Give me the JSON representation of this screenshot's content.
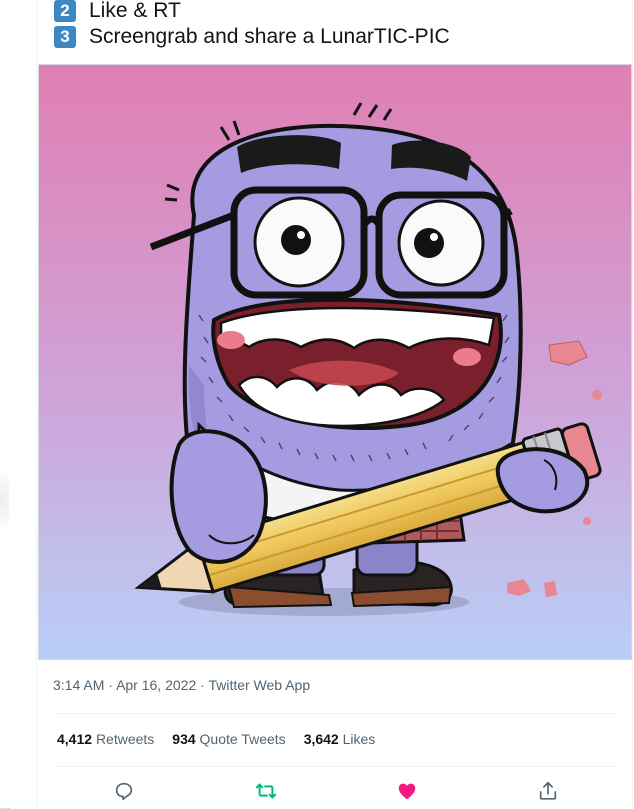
{
  "tweet": {
    "steps": [
      {
        "number": "2",
        "text": "Like & RT"
      },
      {
        "number": "3",
        "text": "Screengrab and share a LunarTIC-PIC"
      }
    ],
    "timestamp": {
      "time": "3:14 AM",
      "separator": "·",
      "date": "Apr 16, 2022",
      "source": "Twitter Web App"
    },
    "stats": {
      "retweets_count": "4,412",
      "retweets_label": "Retweets",
      "quote_count": "934",
      "quote_label": "Quote Tweets",
      "likes_count": "3,642",
      "likes_label": "Likes"
    },
    "actions": {
      "reply_icon": "reply-icon",
      "retweet_icon": "retweet-icon",
      "like_icon": "heart-icon",
      "share_icon": "share-icon"
    },
    "colors": {
      "step_badge": "#3b88c3",
      "retweeted_green": "#00ba7c",
      "liked_pink": "#f91880",
      "muted_text": "#536471"
    }
  },
  "left_gutter": {
    "ellipsis": "..."
  }
}
